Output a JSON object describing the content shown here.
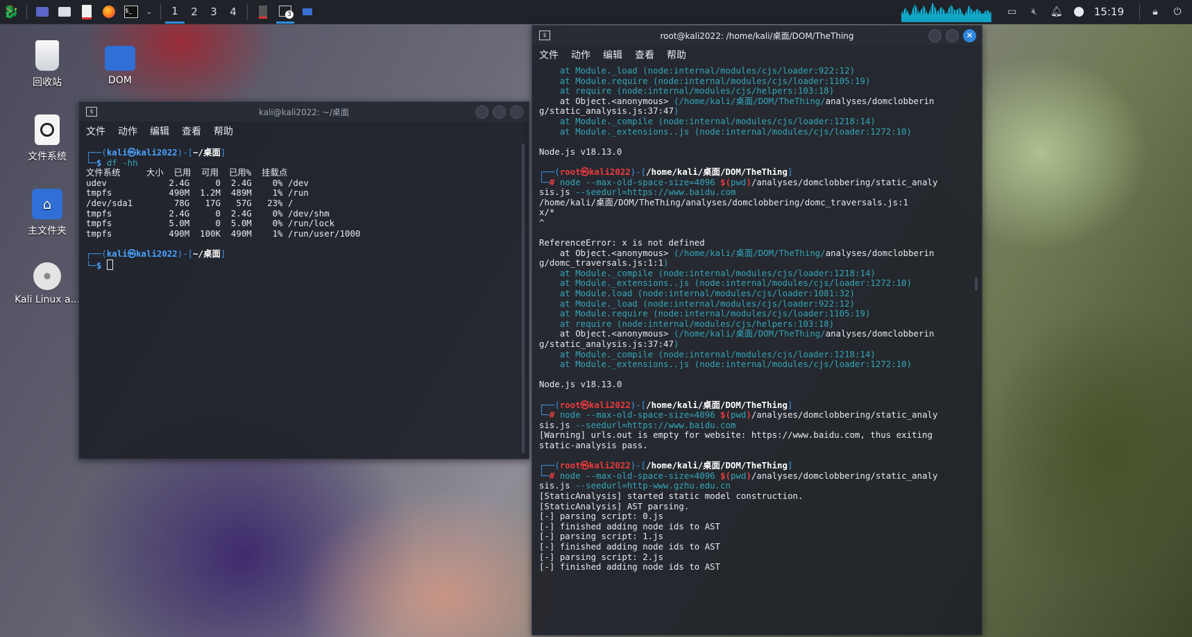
{
  "taskbar": {
    "workspaces": [
      "1",
      "2",
      "3",
      "4"
    ],
    "active_workspace": "1",
    "terminal_badge": "3",
    "clock": "15:19",
    "accent_color": "#2e8fe0"
  },
  "desktop_icons": [
    {
      "label": "回收站",
      "icon": "trash-icon"
    },
    {
      "label": "DOM",
      "icon": "folder-icon"
    },
    {
      "label": "文件系统",
      "icon": "drive-icon"
    },
    {
      "label": "主文件夹",
      "icon": "home-folder-icon"
    },
    {
      "label": "Kali Linux a...",
      "icon": "disc-icon"
    }
  ],
  "left_terminal": {
    "title": "kali@kali2022: ~/桌面",
    "menu": [
      "文件",
      "动作",
      "编辑",
      "查看",
      "帮助"
    ],
    "prompt_user": "kali",
    "prompt_host": "kali2022",
    "prompt_dir": "~/桌面",
    "command": "df -hh",
    "df_header": [
      "文件系统",
      "大小",
      "已用",
      "可用",
      "已用%",
      "挂载点"
    ],
    "df_rows": [
      [
        "udev",
        "2.4G",
        "0",
        "2.4G",
        "0%",
        "/dev"
      ],
      [
        "tmpfs",
        "490M",
        "1.2M",
        "489M",
        "1%",
        "/run"
      ],
      [
        "/dev/sda1",
        "78G",
        "17G",
        "57G",
        "23%",
        "/"
      ],
      [
        "tmpfs",
        "2.4G",
        "0",
        "2.4G",
        "0%",
        "/dev/shm"
      ],
      [
        "tmpfs",
        "5.0M",
        "0",
        "5.0M",
        "0%",
        "/run/lock"
      ],
      [
        "tmpfs",
        "490M",
        "100K",
        "490M",
        "1%",
        "/run/user/1000"
      ]
    ]
  },
  "right_terminal": {
    "title": "root@kali2022: /home/kali/桌面/DOM/TheThing",
    "menu": [
      "文件",
      "动作",
      "编辑",
      "查看",
      "帮助"
    ],
    "lines": [
      {
        "t": "trace",
        "text": "    at Module._load (node:internal/modules/cjs/loader:922:12)"
      },
      {
        "t": "trace",
        "text": "    at Module.require (node:internal/modules/cjs/loader:1105:19)"
      },
      {
        "t": "trace",
        "text": "    at require (node:internal/modules/cjs/helpers:103:18)"
      },
      {
        "t": "obj",
        "a": "    at Object.<anonymous> ",
        "b": "(/home/kali/桌面/DOM/TheThing/",
        "c": "analyses/domclobberin"
      },
      {
        "t": "objcont",
        "a": "g/static_analysis.js:37:47",
        "b": ")"
      },
      {
        "t": "trace",
        "text": "    at Module._compile (node:internal/modules/cjs/loader:1218:14)"
      },
      {
        "t": "trace",
        "text": "    at Module._extensions..js (node:internal/modules/cjs/loader:1272:10)"
      },
      {
        "t": "plain",
        "text": ""
      },
      {
        "t": "plain",
        "text": "Node.js v18.13.0"
      },
      {
        "t": "plain",
        "text": ""
      },
      {
        "t": "prompt",
        "dir": "/home/kali/桌面/DOM/TheThing"
      },
      {
        "t": "cmd",
        "a": "node ",
        "b": "--max-old-space-size=4096 ",
        "c": "$(",
        "d": "pwd",
        "e": ")/analyses/domclobbering/static_analy"
      },
      {
        "t": "cmdcont",
        "a": "sis.js ",
        "b": "--seedurl=https://www.baidu.com"
      },
      {
        "t": "plain",
        "text": "/home/kali/桌面/DOM/TheThing/analyses/domclobbering/domc_traversals.js:1"
      },
      {
        "t": "plain",
        "text": "x/*"
      },
      {
        "t": "plain",
        "text": "^"
      },
      {
        "t": "plain",
        "text": ""
      },
      {
        "t": "plain",
        "text": "ReferenceError: x is not defined"
      },
      {
        "t": "obj",
        "a": "    at Object.<anonymous> ",
        "b": "(/home/kali/桌面/DOM/TheThing/",
        "c": "analyses/domclobberin"
      },
      {
        "t": "objcont",
        "a": "g/domc_traversals.js:1:1",
        "b": ")"
      },
      {
        "t": "trace",
        "text": "    at Module._compile (node:internal/modules/cjs/loader:1218:14)"
      },
      {
        "t": "trace",
        "text": "    at Module._extensions..js (node:internal/modules/cjs/loader:1272:10)"
      },
      {
        "t": "trace",
        "text": "    at Module.load (node:internal/modules/cjs/loader:1081:32)"
      },
      {
        "t": "trace",
        "text": "    at Module._load (node:internal/modules/cjs/loader:922:12)"
      },
      {
        "t": "trace",
        "text": "    at Module.require (node:internal/modules/cjs/loader:1105:19)"
      },
      {
        "t": "trace",
        "text": "    at require (node:internal/modules/cjs/helpers:103:18)"
      },
      {
        "t": "obj",
        "a": "    at Object.<anonymous> ",
        "b": "(/home/kali/桌面/DOM/TheThing/",
        "c": "analyses/domclobberin"
      },
      {
        "t": "objcont",
        "a": "g/static_analysis.js:37:47",
        "b": ")"
      },
      {
        "t": "trace",
        "text": "    at Module._compile (node:internal/modules/cjs/loader:1218:14)"
      },
      {
        "t": "trace",
        "text": "    at Module._extensions..js (node:internal/modules/cjs/loader:1272:10)"
      },
      {
        "t": "plain",
        "text": ""
      },
      {
        "t": "plain",
        "text": "Node.js v18.13.0"
      },
      {
        "t": "plain",
        "text": ""
      },
      {
        "t": "prompt",
        "dir": "/home/kali/桌面/DOM/TheThing"
      },
      {
        "t": "cmd",
        "a": "node ",
        "b": "--max-old-space-size=4096 ",
        "c": "$(",
        "d": "pwd",
        "e": ")/analyses/domclobbering/static_analy"
      },
      {
        "t": "cmdcont",
        "a": "sis.js ",
        "b": "--seedurl=https://www.baidu.com"
      },
      {
        "t": "plain",
        "text": "[Warning] urls.out is empty for website: https://www.baidu.com, thus exiting"
      },
      {
        "t": "plain",
        "text": "static-analysis pass."
      },
      {
        "t": "plain",
        "text": ""
      },
      {
        "t": "prompt",
        "dir": "/home/kali/桌面/DOM/TheThing"
      },
      {
        "t": "cmd",
        "a": "node ",
        "b": "--max-old-space-size=4096 ",
        "c": "$(",
        "d": "pwd",
        "e": ")/analyses/domclobbering/static_analy"
      },
      {
        "t": "cmdcont",
        "a": "sis.js ",
        "b": "--seedurl=http-www.gzhu.edu.cn"
      },
      {
        "t": "plain",
        "text": "[StaticAnalysis] started static model construction."
      },
      {
        "t": "plain",
        "text": "[StaticAnalysis] AST parsing."
      },
      {
        "t": "plain",
        "text": "[-] parsing script: 0.js"
      },
      {
        "t": "plain",
        "text": "[-] finished adding node ids to AST"
      },
      {
        "t": "plain",
        "text": "[-] parsing script: 1.js"
      },
      {
        "t": "plain",
        "text": "[-] finished adding node ids to AST"
      },
      {
        "t": "plain",
        "text": "[-] parsing script: 2.js"
      },
      {
        "t": "plain",
        "text": "[-] finished adding node ids to AST"
      }
    ],
    "root_user": "root",
    "root_host": "kali2022"
  }
}
